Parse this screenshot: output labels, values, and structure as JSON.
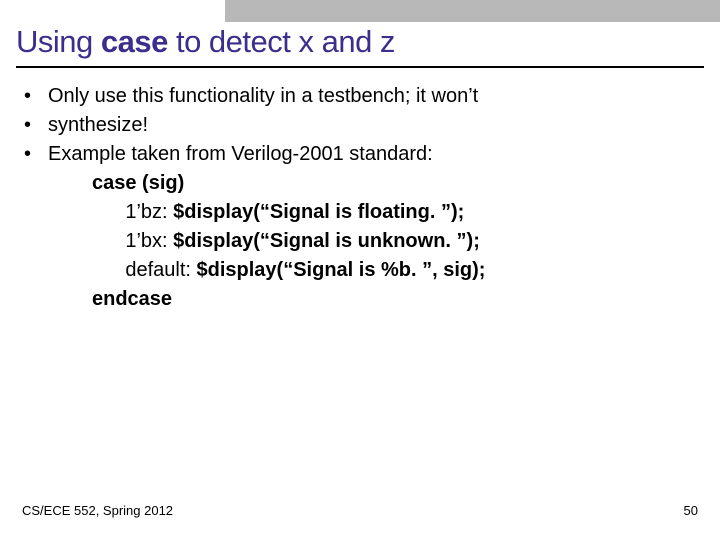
{
  "title": {
    "pre": "Using ",
    "bold": "case",
    "post": " to detect x and z"
  },
  "bullets": [
    "Only use this functionality in a testbench; it won’t",
    "synthesize!",
    " Example taken from Verilog-2001 standard:"
  ],
  "code": {
    "l1": "case (sig)",
    "l2a": "      1’bz: ",
    "l2b": "$display(“Signal is floating. ”);",
    "l3a": "      1’bx: ",
    "l3b": "$display(“Signal is unknown. ”);",
    "l4a": "      default: ",
    "l4b": "$display(“Signal is %b. ”, sig);",
    "l5": "endcase"
  },
  "footer": {
    "left": "CS/ECE 552, Spring 2012",
    "right": "50"
  }
}
